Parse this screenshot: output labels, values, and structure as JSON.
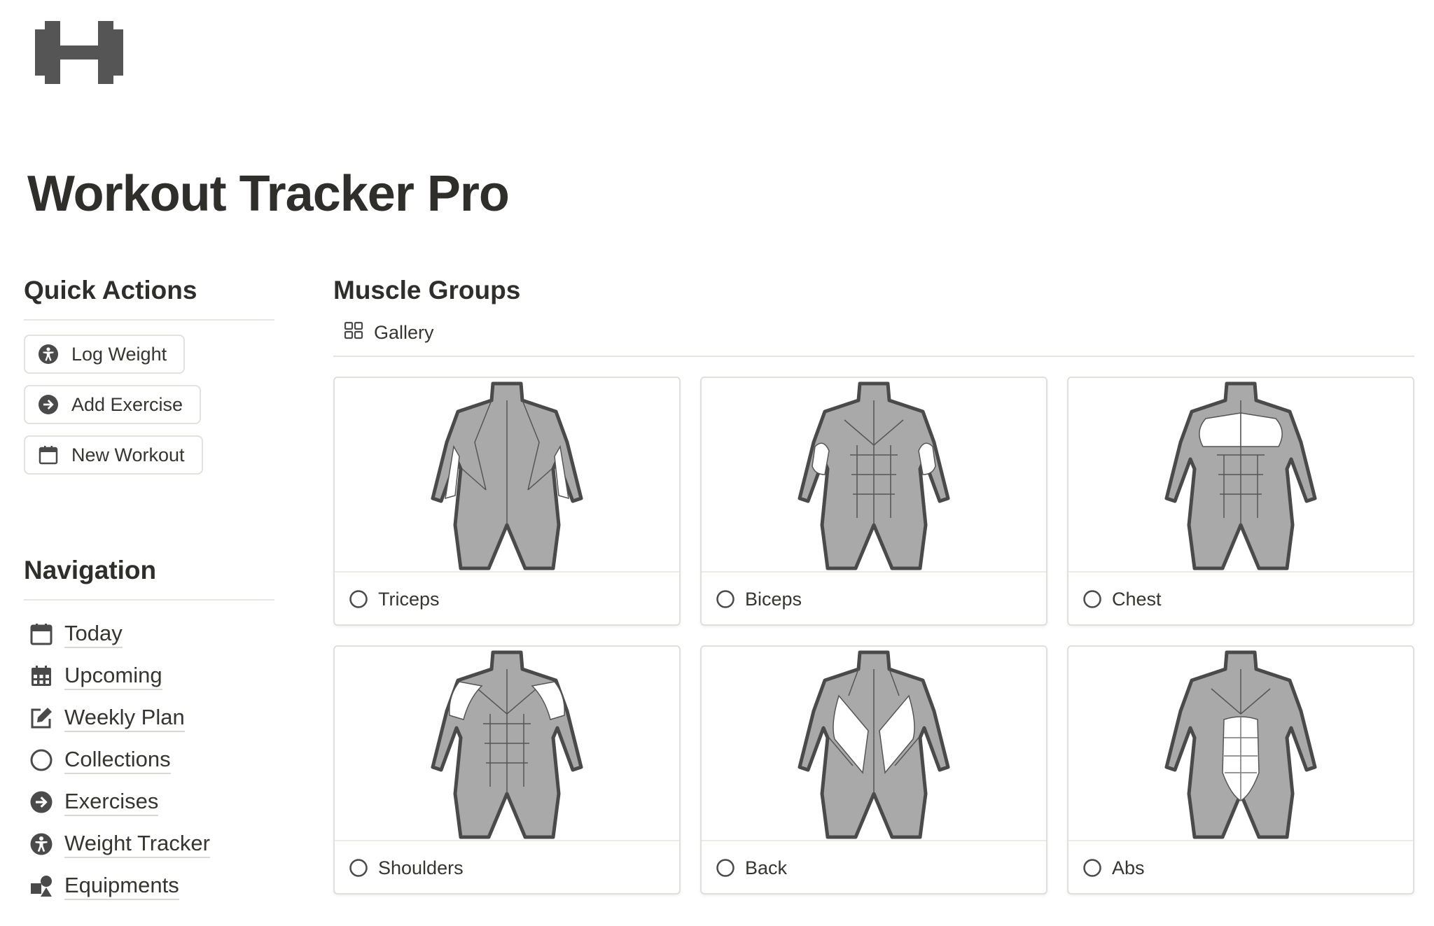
{
  "page": {
    "title": "Workout Tracker Pro",
    "icon": "dumbbell-icon"
  },
  "quick_actions": {
    "title": "Quick Actions",
    "buttons": [
      {
        "label": "Log Weight",
        "icon": "accessibility-icon"
      },
      {
        "label": "Add Exercise",
        "icon": "arrow-right-circle-icon"
      },
      {
        "label": "New Workout",
        "icon": "calendar-icon"
      }
    ]
  },
  "navigation": {
    "title": "Navigation",
    "items": [
      {
        "label": "Today",
        "icon": "calendar-icon"
      },
      {
        "label": "Upcoming",
        "icon": "calendar-grid-icon"
      },
      {
        "label": "Weekly Plan",
        "icon": "edit-icon"
      },
      {
        "label": "Collections",
        "icon": "circle-icon"
      },
      {
        "label": "Exercises",
        "icon": "arrow-right-circle-icon"
      },
      {
        "label": "Weight Tracker",
        "icon": "accessibility-icon"
      },
      {
        "label": "Equipments",
        "icon": "shapes-icon"
      }
    ]
  },
  "muscle_groups": {
    "title": "Muscle Groups",
    "view_tab": {
      "label": "Gallery",
      "icon": "gallery-grid-icon"
    },
    "cards": [
      {
        "title": "Triceps",
        "figure": "back-view",
        "highlight": "triceps"
      },
      {
        "title": "Biceps",
        "figure": "front-view",
        "highlight": "biceps"
      },
      {
        "title": "Chest",
        "figure": "front-view",
        "highlight": "chest"
      },
      {
        "title": "Shoulders",
        "figure": "front-view",
        "highlight": "shoulders"
      },
      {
        "title": "Back",
        "figure": "back-view",
        "highlight": "back"
      },
      {
        "title": "Abs",
        "figure": "front-view",
        "highlight": "abs"
      }
    ]
  },
  "colors": {
    "text": "#37352f",
    "muscle": "#a9a9a9",
    "outline": "#4a4a4a",
    "highlight": "#ffffff"
  }
}
